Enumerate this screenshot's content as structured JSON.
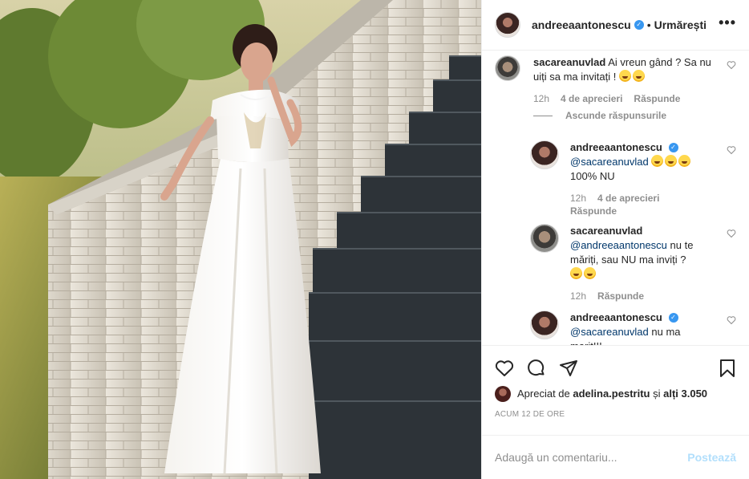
{
  "post": {
    "owner": "andreeaantonescu",
    "separator": "•",
    "follow_label": "Urmărești",
    "more_label": "•••"
  },
  "comments": [
    {
      "user": "sacareanuvlad",
      "text": "Ai vreun gând ? Sa nu uiți sa ma invitați !",
      "time": "12h",
      "date": "4 de aprecieri",
      "reply": "Răspunde",
      "verified": false
    },
    {
      "user": "andreeaantonescu",
      "mention": "@sacareanuvlad",
      "text": "100% NU",
      "time": "12h",
      "date": "4 de aprecieri",
      "reply": "Răspunde",
      "verified": true
    },
    {
      "user": "sacareanuvlad",
      "mention": "@andreeaantonescu",
      "text": "nu te măriți, sau NU ma inviți ?",
      "time": "12h",
      "reply": "Răspunde",
      "verified": false
    },
    {
      "user": "andreeaantonescu",
      "mention": "@sacareanuvlad",
      "text": "nu ma marit!!!",
      "verified": true
    }
  ],
  "hide_replies": "Ascunde răspunsurile",
  "likes": {
    "prefix": "Apreciat de",
    "user": "adelina.pestritu",
    "middle": "și",
    "others": "alți 3.050"
  },
  "time_ago": "ACUM 12 DE ORE",
  "add_comment": {
    "placeholder": "Adaugă un comentariu...",
    "post_label": "Postează"
  },
  "colors": {
    "link": "#00376b",
    "verified": "#3897f0",
    "post_button": "#b2dffc",
    "muted": "#8e8e8e"
  }
}
